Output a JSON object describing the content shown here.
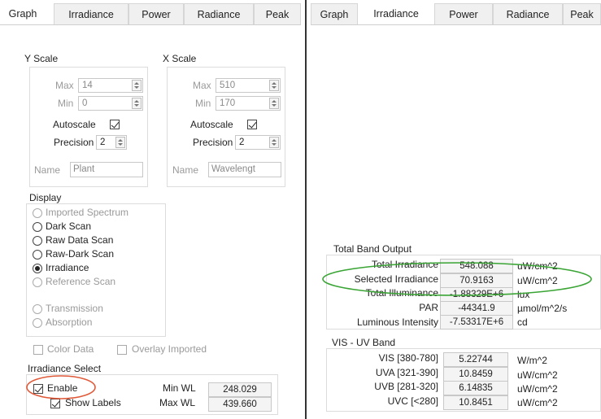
{
  "left_tabs": [
    "Graph",
    "Irradiance",
    "Power",
    "Radiance",
    "Peak"
  ],
  "right_tabs": [
    "Graph",
    "Irradiance",
    "Power",
    "Radiance",
    "Peak"
  ],
  "yscale": {
    "title": "Y Scale",
    "max_label": "Max",
    "max_value": "14",
    "min_label": "Min",
    "min_value": "0",
    "autoscale_label": "Autoscale",
    "precision_label": "Precision",
    "precision_value": "2",
    "name_label": "Name",
    "name_value": "Plant"
  },
  "xscale": {
    "title": "X Scale",
    "max_label": "Max",
    "max_value": "510",
    "min_label": "Min",
    "min_value": "170",
    "autoscale_label": "Autoscale",
    "precision_label": "Precision",
    "precision_value": "2",
    "name_label": "Name",
    "name_value": "Wavelengt"
  },
  "display": {
    "title": "Display",
    "options": [
      "Imported Spectrum",
      "Dark Scan",
      "Raw Data Scan",
      "Raw-Dark Scan",
      "Irradiance",
      "Reference Scan",
      "Transmission",
      "Absorption"
    ],
    "selected": "Irradiance",
    "color_data_label": "Color Data",
    "overlay_label": "Overlay Imported"
  },
  "irradiance_select": {
    "title": "Irradiance Select",
    "enable_label": "Enable",
    "show_labels_label": "Show Labels",
    "min_wl_label": "Min WL",
    "min_wl_value": "248.029",
    "max_wl_label": "Max WL",
    "max_wl_value": "439.660"
  },
  "total_band": {
    "title": "Total  Band Output",
    "rows": [
      {
        "label": "Total Irradiance",
        "value": "548.088",
        "unit": "uW/cm^2"
      },
      {
        "label": "Selected Irradiance",
        "value": "70.9163",
        "unit": "uW/cm^2"
      },
      {
        "label": "Total Illuminance",
        "value": "-1.88329E+6",
        "unit": "lux"
      },
      {
        "label": "PAR",
        "value": "-44341.9",
        "unit": "µmol/m^2/s"
      },
      {
        "label": "Luminous Intensity",
        "value": "-7.53317E+6",
        "unit": "cd"
      }
    ]
  },
  "vis_uv": {
    "title": "VIS - UV Band",
    "rows": [
      {
        "label": "VIS [380-780]",
        "value": "5.22744",
        "unit": "W/m^2"
      },
      {
        "label": "UVA [321-390]",
        "value": "10.8459",
        "unit": "uW/cm^2"
      },
      {
        "label": "UVB [281-320]",
        "value": "6.14835",
        "unit": "uW/cm^2"
      },
      {
        "label": "UVC [<280]",
        "value": "10.8451",
        "unit": "uW/cm^2"
      }
    ]
  },
  "colors": {
    "annotation": "#e05a3a",
    "highlight": "#3aa535",
    "divider": "#333333"
  }
}
